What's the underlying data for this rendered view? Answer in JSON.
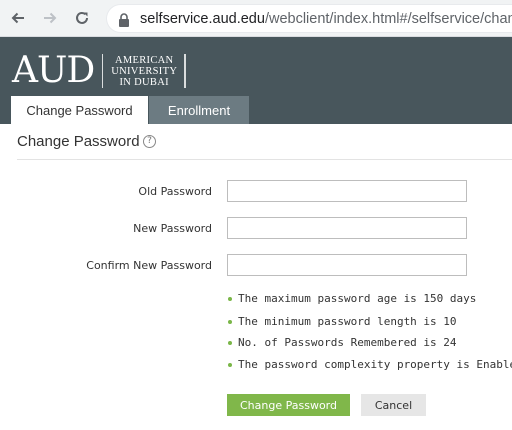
{
  "browser": {
    "url_host": "selfservice.aud.edu",
    "url_path": "/webclient/index.html#/selfservice/change",
    "icons": [
      "arrow-left-icon",
      "arrow-right-icon",
      "reload-icon",
      "lock-icon"
    ]
  },
  "header": {
    "logo_letters": "AUD",
    "logo_line1": "AMERICAN",
    "logo_line2": "UNIVERSITY",
    "logo_line3": "IN DUBAI",
    "bg_color": "#48565c"
  },
  "tabs": [
    {
      "label": "Change Password",
      "active": true
    },
    {
      "label": "Enrollment",
      "active": false
    }
  ],
  "page": {
    "title": "Change Password",
    "help_symbol": "?"
  },
  "form": {
    "old_password_label": "Old Password",
    "new_password_label": "New Password",
    "confirm_password_label": "Confirm New Password",
    "old_password_value": "",
    "new_password_value": "",
    "confirm_password_value": ""
  },
  "policy_rules": [
    "The maximum password age is 150 days",
    "The minimum password length is 10",
    "No. of Passwords Remembered is 24",
    "The password complexity property is Enabled"
  ],
  "actions": {
    "submit_label": "Change Password",
    "cancel_label": "Cancel",
    "accent_color": "#80b74a"
  }
}
